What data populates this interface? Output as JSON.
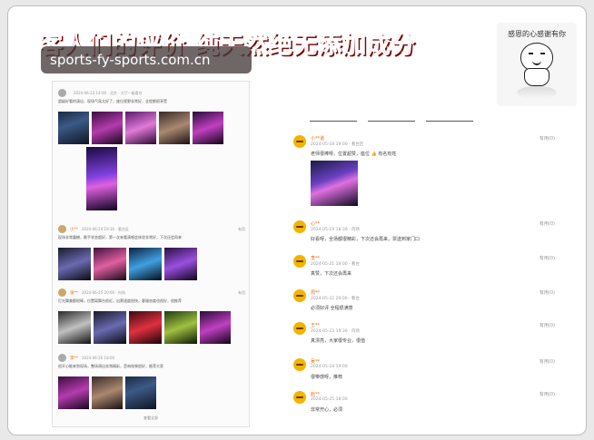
{
  "headline": "客人们的评价 纯天然绝无添加成分",
  "watermark": "sports-fy-sports.com.cn",
  "sticker": {
    "text": "感恩的心感谢有你"
  },
  "left_panel": {
    "posts": [
      {
        "name": "",
        "date": "2024-06-23 14:00 · 北京 · 大厅一级看台",
        "rating": "",
        "text": "超级好看的演出，现场气氛太好了，座位视野非常好，全程都很享受"
      },
      {
        "name": "小**",
        "date": "2024-06-24 19:30 · 看台区",
        "rating": "有用",
        "text": "现场非常震撼，歌手状态超好，第一次来看演唱会体验非常好，下次还会再来"
      },
      {
        "name": "张**",
        "date": "2024-06-25 20:00 · 内场",
        "rating": "有用",
        "text": "灯光舞美都很棒，位置离舞台很近，出票速度很快，客服态度也很好，很推荐"
      },
      {
        "name": "李**",
        "date": "2024-06-26 18:00",
        "rating": "",
        "text": "很开心能来到现场，整场演出非常精彩，音响效果很好，推荐大家"
      }
    ],
    "footer": "查看全部"
  },
  "right_panel": {
    "reviews": [
      {
        "name": "小**道",
        "date": "2024-05-18 19:00 · 看台区",
        "likes": "有用(0)",
        "text": "老师很棒呀，位置超赞，座位 👍 有名有姓"
      },
      {
        "name": "心**",
        "date": "2024-05-19 18:30 · 内场",
        "likes": "有用(0)",
        "text": "好看呀，全场都很精彩，下次还会再来，票送到家门口"
      },
      {
        "name": "李**",
        "date": "2024-05-21 19:00 · 看台",
        "likes": "有用(0)",
        "text": "真赞，下次还会再来"
      },
      {
        "name": "周**",
        "date": "2024-05-22 20:00 · 看台",
        "likes": "有用(0)",
        "text": "必须好评 全程很满意"
      },
      {
        "name": "王**",
        "date": "2024-05-23 19:30 · 内场",
        "likes": "有用(0)",
        "text": "真漂亮，大家很专业，很值"
      },
      {
        "name": "吴**",
        "date": "2024-05-24 19:00",
        "likes": "有用(0)",
        "text": "很带感呀，推荐"
      },
      {
        "name": "赵**",
        "date": "2024-05-25 18:00",
        "likes": "有用(0)",
        "text": "非常开心，必须"
      }
    ]
  },
  "colors": {
    "headline": "#e8202a",
    "name": "#e06b10"
  }
}
